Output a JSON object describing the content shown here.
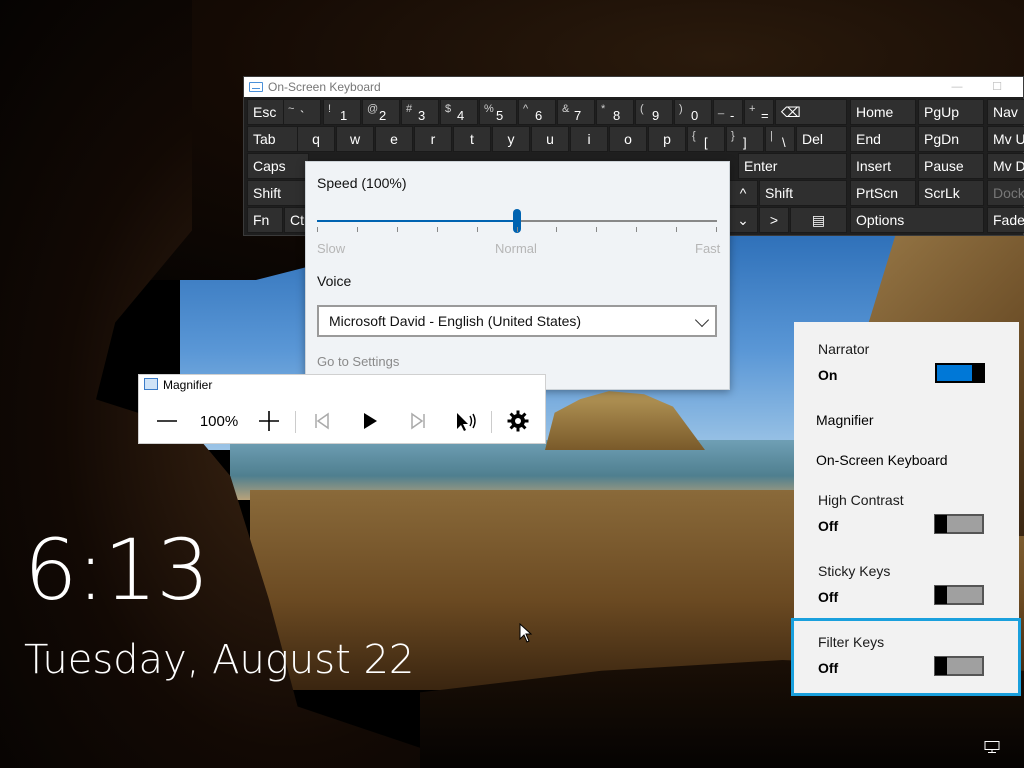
{
  "lockscreen": {
    "time": "6:13",
    "date": "Tuesday, August 22"
  },
  "osk": {
    "title": "On-Screen Keyboard",
    "icon": "keyboard-icon",
    "rows": [
      [
        {
          "label": "Esc"
        },
        {
          "sup": "~",
          "main": "`"
        },
        {
          "sup": "!",
          "main": "1"
        },
        {
          "sup": "@",
          "main": "2"
        },
        {
          "sup": "#",
          "main": "3"
        },
        {
          "sup": "$",
          "main": "4"
        },
        {
          "sup": "%",
          "main": "5"
        },
        {
          "sup": "^",
          "main": "6"
        },
        {
          "sup": "&",
          "main": "7"
        },
        {
          "sup": "*",
          "main": "8"
        },
        {
          "sup": "(",
          "main": "9"
        },
        {
          "sup": ")",
          "main": "0"
        },
        {
          "sup": "_",
          "main": "-"
        },
        {
          "sup": "+",
          "main": "="
        },
        {
          "label": "⌫"
        },
        {
          "label": "Home"
        },
        {
          "label": "PgUp"
        },
        {
          "label": "Nav"
        }
      ],
      [
        {
          "label": "Tab"
        },
        {
          "label": "q"
        },
        {
          "label": "w"
        },
        {
          "label": "e"
        },
        {
          "label": "r"
        },
        {
          "label": "t"
        },
        {
          "label": "y"
        },
        {
          "label": "u"
        },
        {
          "label": "i"
        },
        {
          "label": "o"
        },
        {
          "label": "p"
        },
        {
          "sup": "{",
          "main": "["
        },
        {
          "sup": "}",
          "main": "]"
        },
        {
          "sup": "|",
          "main": "\\"
        },
        {
          "label": "Del"
        },
        {
          "label": "End"
        },
        {
          "label": "PgDn"
        },
        {
          "label": "Mv Up"
        }
      ],
      [
        {
          "label": "Caps"
        },
        {
          "label": "Enter"
        },
        {
          "label": "Insert"
        },
        {
          "label": "Pause"
        },
        {
          "label": "Mv Dn"
        }
      ],
      [
        {
          "label": "Shift"
        },
        {
          "label": "^"
        },
        {
          "label": "Shift"
        },
        {
          "label": "PrtScn"
        },
        {
          "label": "ScrLk"
        },
        {
          "label": "Dock"
        }
      ],
      [
        {
          "label": "Fn"
        },
        {
          "label": "Ctrl"
        },
        {
          "label": "⌄"
        },
        {
          "label": ">"
        },
        {
          "label": "▤"
        },
        {
          "label": "Options"
        },
        {
          "label": "Fade"
        }
      ]
    ]
  },
  "narrator_speed": {
    "speed_label": "Speed (100%)",
    "slider_value_fraction": 0.5,
    "tick_count": 11,
    "min_label": "Slow",
    "mid_label": "Normal",
    "max_label": "Fast",
    "voice_label": "Voice",
    "voice_selected": "Microsoft David - English (United States)",
    "goto_settings": "Go to Settings"
  },
  "magnifier": {
    "title": "Magnifier",
    "zoom": "100%",
    "icons": [
      "minus-icon",
      "plus-icon",
      "previous-icon",
      "play-icon",
      "next-icon",
      "read-from-cursor-icon",
      "gear-icon"
    ]
  },
  "ease_of_access": {
    "items": [
      {
        "name": "Narrator",
        "state": "On"
      },
      {
        "name": "Magnifier"
      },
      {
        "name": "On-Screen Keyboard"
      },
      {
        "name": "High Contrast",
        "state": "Off"
      },
      {
        "name": "Sticky Keys",
        "state": "Off"
      },
      {
        "name": "Filter Keys",
        "state": "Off"
      }
    ],
    "colors": {
      "toggle_on": "#0078d7",
      "focus_ring": "#1aa0dd"
    }
  },
  "taskbar": {
    "network_icon": "network-icon"
  }
}
